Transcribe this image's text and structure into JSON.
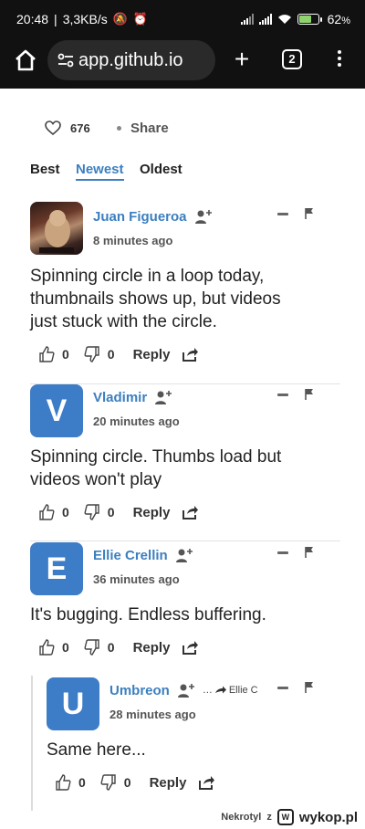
{
  "status_bar": {
    "time": "20:48",
    "speed": "3,3KB/s",
    "battery": "62",
    "battery_unit": "%",
    "battery_level": 0.62
  },
  "browser": {
    "url": "app.github.io",
    "tab_count": "2"
  },
  "post": {
    "like_count": "676",
    "share_label": "Share"
  },
  "sort": {
    "tabs": [
      "Best",
      "Newest",
      "Oldest"
    ],
    "active": "Newest"
  },
  "comments": [
    {
      "author": "Juan Figueroa",
      "avatar_letter": "",
      "time": "8 minutes ago",
      "text_lines": [
        "Spinning circle in a loop today,",
        "thumbnails shows up, but videos",
        "just stuck with the circle."
      ],
      "upvotes": "0",
      "downvotes": "0",
      "reply_label": "Reply"
    },
    {
      "author": "Vladimir",
      "avatar_letter": "V",
      "time": "20 minutes ago",
      "text_lines": [
        "Spinning circle. Thumbs load but",
        "videos won't play"
      ],
      "upvotes": "0",
      "downvotes": "0",
      "reply_label": "Reply"
    },
    {
      "author": "Ellie Crellin",
      "avatar_letter": "E",
      "time": "36 minutes ago",
      "text_lines": [
        "It's bugging. Endless buffering."
      ],
      "upvotes": "0",
      "downvotes": "0",
      "reply_label": "Reply"
    },
    {
      "author": "Umbreon",
      "avatar_letter": "U",
      "reply_to": "Ellie C",
      "time": "28 minutes ago",
      "text_lines": [
        "Same here..."
      ],
      "upvotes": "0",
      "downvotes": "0",
      "reply_label": "Reply"
    }
  ],
  "watermark": {
    "user": "Nekrotyl",
    "connector": "z",
    "site": "wykop.pl"
  },
  "colors": {
    "accent": "#3c7fbf",
    "avatar_blue": "#3d7cc6",
    "chrome_bg": "#111111"
  }
}
